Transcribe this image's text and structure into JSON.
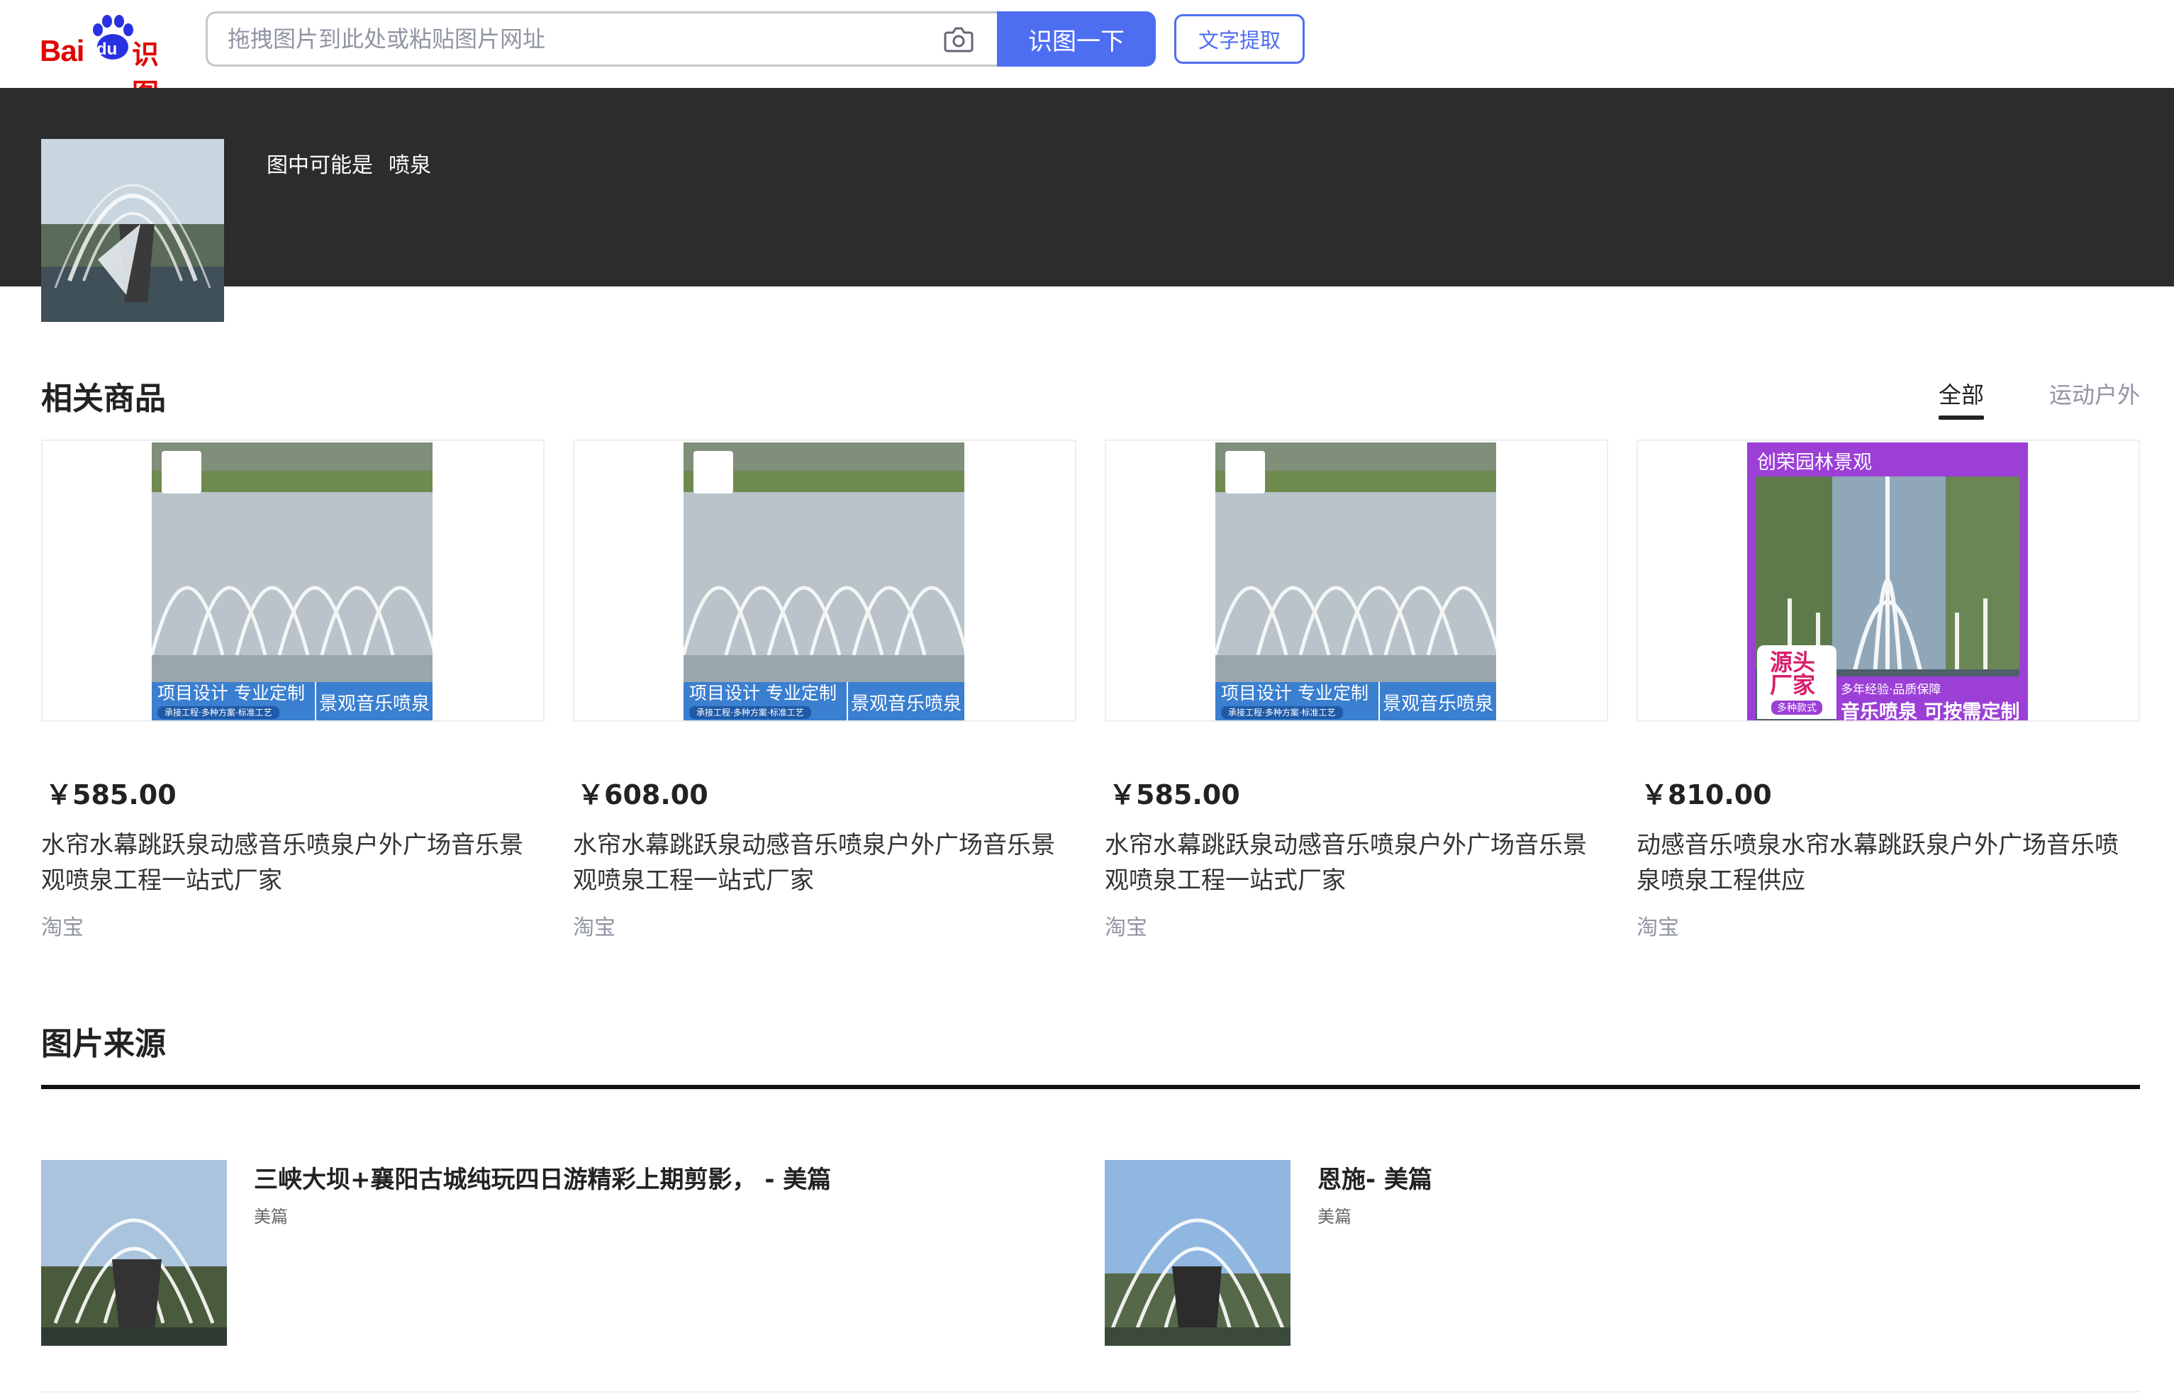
{
  "header": {
    "logo_bai": "Bai",
    "logo_du": "du",
    "logo_shitu": "识图",
    "search_placeholder": "拖拽图片到此处或粘贴图片网址",
    "search_button": "识图一下",
    "ocr_button": "文字提取"
  },
  "result": {
    "guess_prefix": "图中可能是",
    "guess_value": "喷泉"
  },
  "products_section": {
    "title": "相关商品",
    "tabs": [
      {
        "label": "全部",
        "active": true
      },
      {
        "label": "运动户外",
        "active": false
      }
    ],
    "items": [
      {
        "price": "￥585.00",
        "title": "水帘水幕跳跃泉动感音乐喷泉户外广场音乐景观喷泉工程一站式厂家",
        "source": "淘宝",
        "banner_main": "项目设计 专业定制",
        "banner_sub": "承接工程·多种方案·标准工艺",
        "banner_right": "景观音乐喷泉"
      },
      {
        "price": "￥608.00",
        "title": "水帘水幕跳跃泉动感音乐喷泉户外广场音乐景观喷泉工程一站式厂家",
        "source": "淘宝",
        "banner_main": "项目设计 专业定制",
        "banner_sub": "承接工程·多种方案·标准工艺",
        "banner_right": "景观音乐喷泉"
      },
      {
        "price": "￥585.00",
        "title": "水帘水幕跳跃泉动感音乐喷泉户外广场音乐景观喷泉工程一站式厂家",
        "source": "淘宝",
        "banner_main": "项目设计 专业定制",
        "banner_sub": "承接工程·多种方案·标准工艺",
        "banner_right": "景观音乐喷泉"
      },
      {
        "price": "￥810.00",
        "title": "动感音乐喷泉水帘水幕跳跃泉户外广场音乐喷泉喷泉工程供应",
        "source": "淘宝",
        "banner_top": "创荣园林景观",
        "banner_yuantou": "源头厂家",
        "banner_small": "多种款式",
        "banner_r1": "多年经验·品质保障",
        "banner_r2": "音乐喷泉 可按需定制"
      }
    ]
  },
  "sources_section": {
    "title": "图片来源",
    "items": [
      {
        "title": "三峡大坝+襄阳古城纯玩四日游精彩上期剪影， - 美篇",
        "site": "美篇"
      },
      {
        "title": "恩施- 美篇",
        "site": "美篇"
      }
    ]
  },
  "colors": {
    "brand_red": "#e10602",
    "accent_blue": "#4e6ef2",
    "band_dark": "#2c2c2c",
    "promo_purple": "#9b3fd6",
    "promo_blue": "#3a7fd0"
  }
}
